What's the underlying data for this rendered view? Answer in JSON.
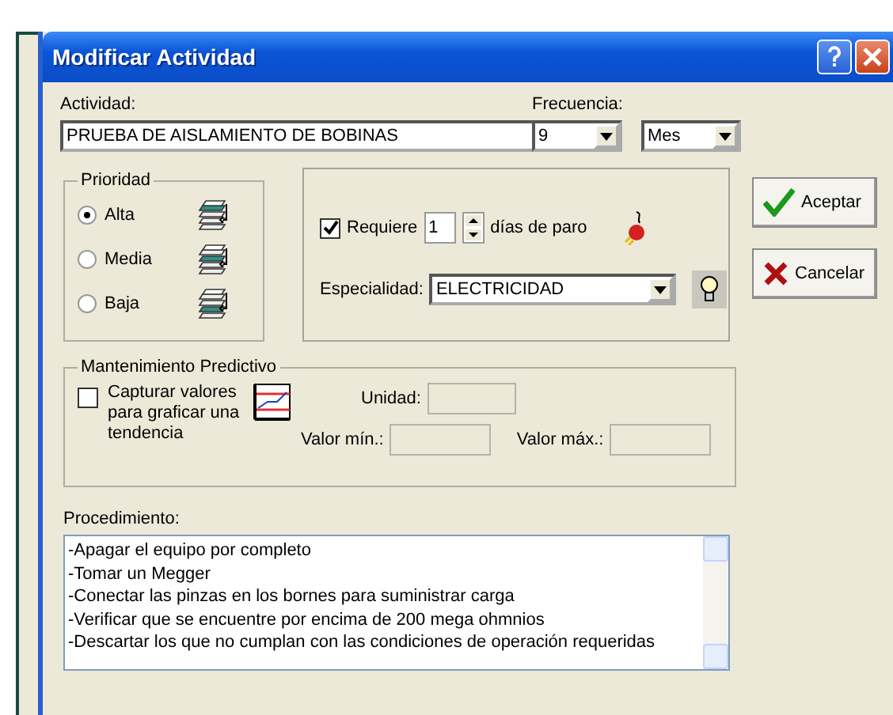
{
  "window": {
    "title": "Modificar Actividad"
  },
  "actividad": {
    "label": "Actividad:",
    "value": "PRUEBA DE AISLAMIENTO DE BOBINAS"
  },
  "frecuencia": {
    "label": "Frecuencia:",
    "value": "9",
    "unit": "Mes"
  },
  "prioridad": {
    "title": "Prioridad",
    "options": [
      {
        "label": "Alta",
        "selected": true
      },
      {
        "label": "Media",
        "selected": false
      },
      {
        "label": "Baja",
        "selected": false
      }
    ]
  },
  "paro": {
    "checked": true,
    "label": "Requiere",
    "days": "1",
    "suffix": "días de paro"
  },
  "especialidad": {
    "label": "Especialidad:",
    "value": "ELECTRICIDAD"
  },
  "buttons": [
    {
      "kind": "ok",
      "label": "Aceptar"
    },
    {
      "kind": "cancel",
      "label": "Cancelar"
    }
  ],
  "predictivo": {
    "title": "Mantenimiento Predictivo",
    "capture": {
      "checked": false,
      "label": "Capturar valores para graficar una tendencia"
    },
    "unidad": "Unidad:",
    "min": "Valor mín.:",
    "max": "Valor máx.:"
  },
  "procedimiento": {
    "label": "Procedimiento:",
    "lines": [
      "-Apagar el equipo por completo",
      "-Tomar un Megger",
      "-Conectar las pinzas en los bornes para suministrar carga",
      "-Verificar que se encuentre por encima de 200 mega ohmnios",
      "-Descartar los que no cumplan con las condiciones de operación requeridas"
    ]
  }
}
